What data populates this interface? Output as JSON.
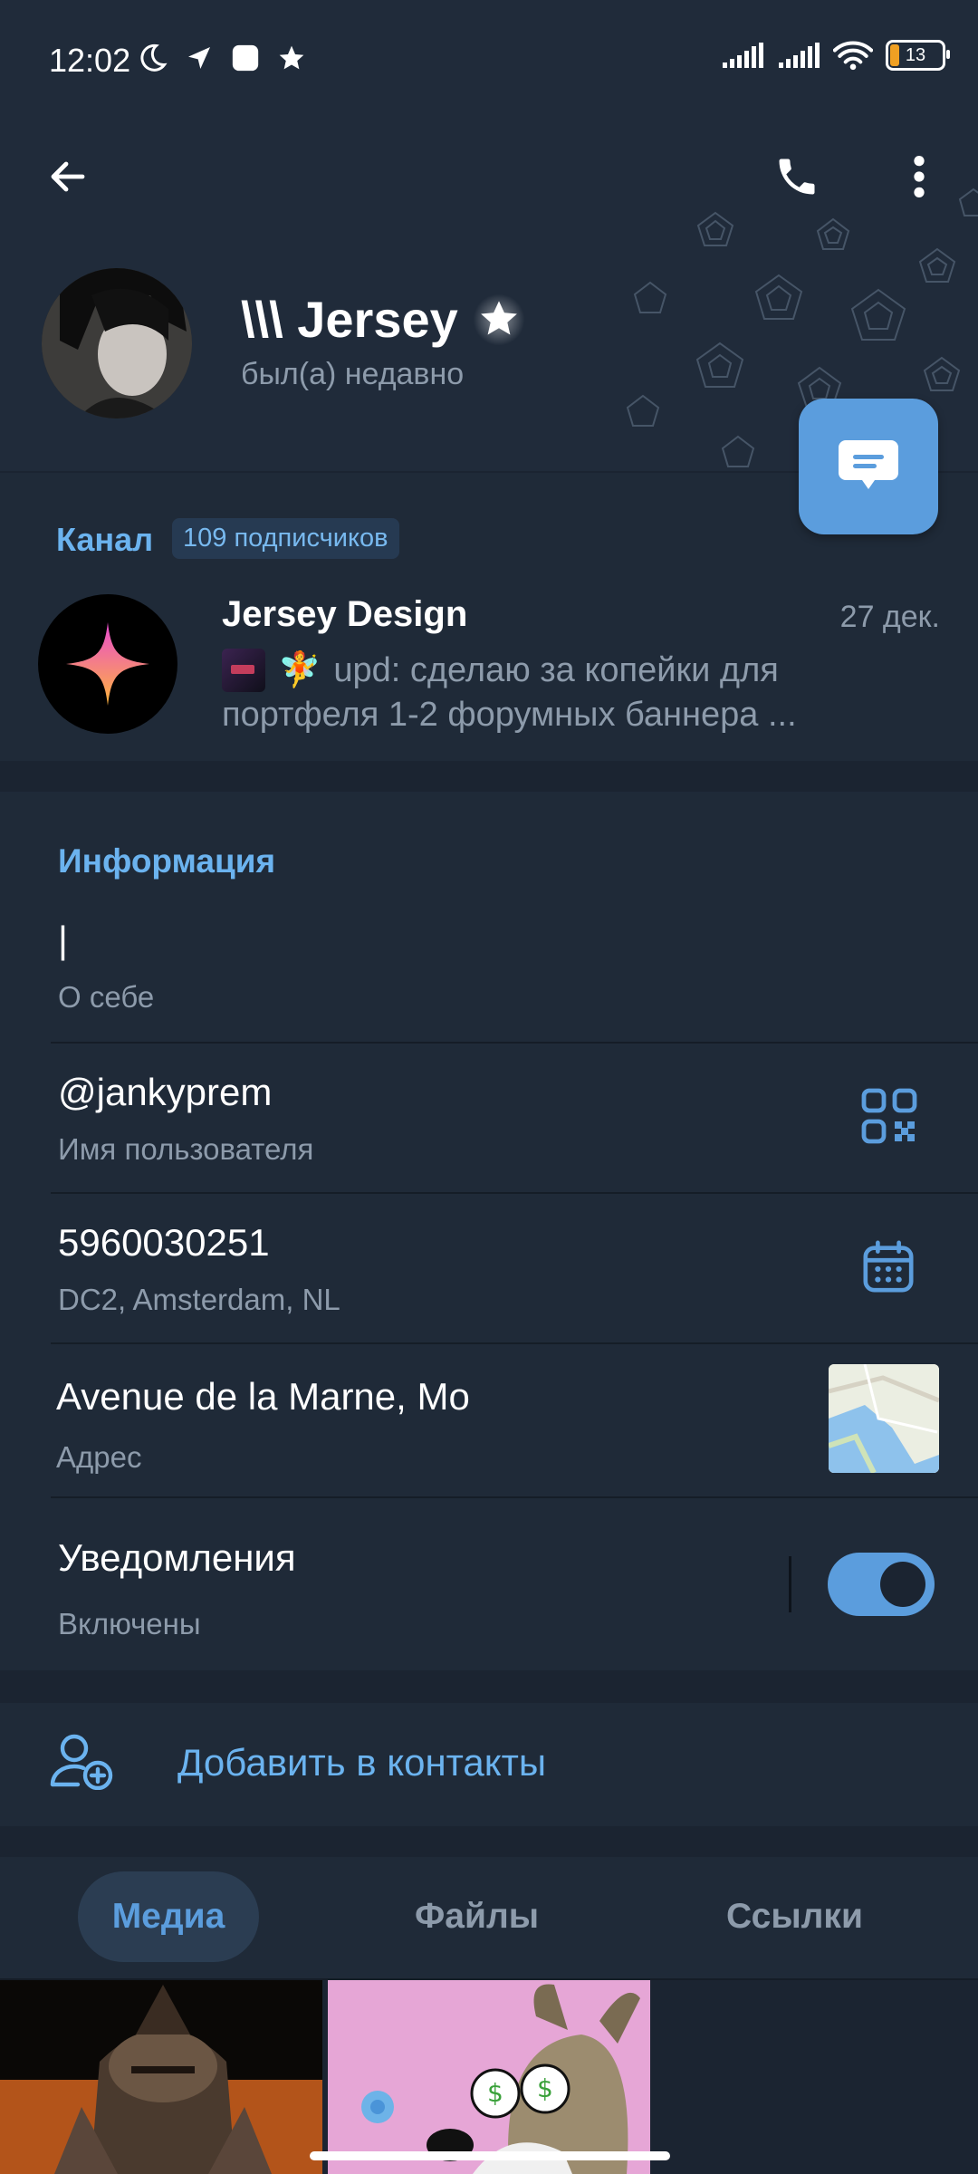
{
  "status_bar": {
    "time": "12:02",
    "battery": "13"
  },
  "profile": {
    "name": "\\\\\\ Jersey",
    "last_seen": "был(а) недавно"
  },
  "channel": {
    "section_label": "Канал",
    "subscribers": "109 подписчиков",
    "title": "Jersey Design",
    "date": "27 дек.",
    "preview_line1": "upd: сделаю за копейки для",
    "preview_line2": "портфеля 1-2 форумных баннера ...",
    "emoji": "🧚"
  },
  "info": {
    "title": "Информация",
    "bio_value": "|",
    "bio_label": "О себе",
    "username_value": "@jankyprem",
    "username_label": "Имя пользователя",
    "id_value": "5960030251",
    "id_label": "DC2, Amsterdam, NL",
    "address_value": "Avenue de la Marne, Mo",
    "address_label": "Адрес",
    "notifications_value": "Уведомления",
    "notifications_label": "Включены",
    "notifications_enabled": true
  },
  "add_contact": {
    "label": "Добавить в контакты"
  },
  "tabs": [
    {
      "label": "Медиа",
      "active": true
    },
    {
      "label": "Файлы",
      "active": false
    },
    {
      "label": "Ссылки",
      "active": false
    }
  ],
  "colors": {
    "accent": "#5b9ddd",
    "background": "#1b2431",
    "section": "#1f2a38"
  }
}
